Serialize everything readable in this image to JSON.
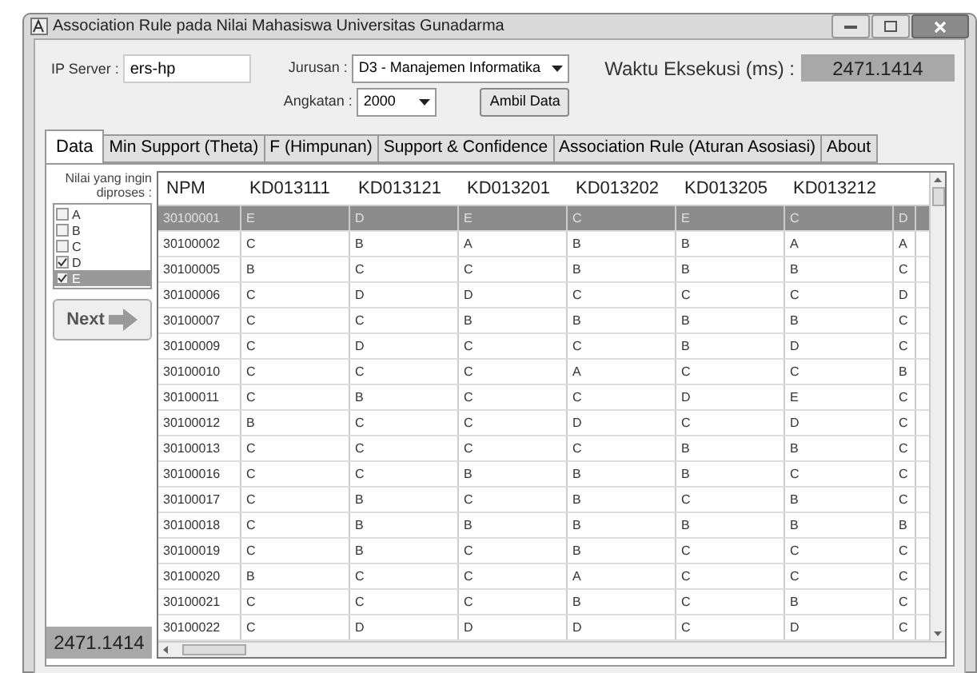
{
  "window": {
    "title": "Association Rule pada Nilai Mahasiswa Universitas Gunadarma"
  },
  "top": {
    "ip_label": "IP Server :",
    "ip_value": "ers-hp",
    "jurusan_label": "Jurusan :",
    "jurusan_value": "D3 - Manajemen Informatika",
    "angkatan_label": "Angkatan :",
    "angkatan_value": "2000",
    "fetch_button": "Ambil Data",
    "time_label": "Waktu Eksekusi (ms) :",
    "time_value": "2471.1414"
  },
  "tabs": [
    {
      "label": "Data",
      "selected": true
    },
    {
      "label": "Min Support (Theta)",
      "selected": false
    },
    {
      "label": "F (Himpunan)",
      "selected": false
    },
    {
      "label": "Support & Confidence",
      "selected": false
    },
    {
      "label": "Association Rule (Aturan Asosiasi)",
      "selected": false
    },
    {
      "label": "About",
      "selected": false
    }
  ],
  "filter": {
    "label": "Nilai yang ingin diproses :",
    "options": [
      {
        "label": "A",
        "checked": false,
        "selected": false
      },
      {
        "label": "B",
        "checked": false,
        "selected": false
      },
      {
        "label": "C",
        "checked": false,
        "selected": false
      },
      {
        "label": "D",
        "checked": true,
        "selected": false
      },
      {
        "label": "E",
        "checked": true,
        "selected": true
      }
    ],
    "next_button": "Next",
    "time_value": "2471.1414"
  },
  "table": {
    "columns": [
      "NPM",
      "KD013111",
      "KD013121",
      "KD013201",
      "KD013202",
      "KD013205",
      "KD013212"
    ],
    "rows": [
      {
        "selected": true,
        "cells": [
          "30100001",
          "E",
          "D",
          "E",
          "C",
          "E",
          "C",
          "D"
        ]
      },
      {
        "selected": false,
        "cells": [
          "30100002",
          "C",
          "B",
          "A",
          "B",
          "B",
          "A",
          "A"
        ]
      },
      {
        "selected": false,
        "cells": [
          "30100005",
          "B",
          "C",
          "C",
          "B",
          "B",
          "B",
          "C"
        ]
      },
      {
        "selected": false,
        "cells": [
          "30100006",
          "C",
          "D",
          "D",
          "C",
          "C",
          "C",
          "D"
        ]
      },
      {
        "selected": false,
        "cells": [
          "30100007",
          "C",
          "C",
          "B",
          "B",
          "B",
          "B",
          "C"
        ]
      },
      {
        "selected": false,
        "cells": [
          "30100009",
          "C",
          "D",
          "C",
          "C",
          "B",
          "D",
          "C"
        ]
      },
      {
        "selected": false,
        "cells": [
          "30100010",
          "C",
          "C",
          "C",
          "A",
          "C",
          "C",
          "B"
        ]
      },
      {
        "selected": false,
        "cells": [
          "30100011",
          "C",
          "B",
          "C",
          "C",
          "D",
          "E",
          "C"
        ]
      },
      {
        "selected": false,
        "cells": [
          "30100012",
          "B",
          "C",
          "C",
          "D",
          "C",
          "D",
          "C"
        ]
      },
      {
        "selected": false,
        "cells": [
          "30100013",
          "C",
          "C",
          "C",
          "C",
          "B",
          "B",
          "C"
        ]
      },
      {
        "selected": false,
        "cells": [
          "30100016",
          "C",
          "C",
          "B",
          "B",
          "B",
          "C",
          "C"
        ]
      },
      {
        "selected": false,
        "cells": [
          "30100017",
          "C",
          "B",
          "C",
          "B",
          "C",
          "B",
          "C"
        ]
      },
      {
        "selected": false,
        "cells": [
          "30100018",
          "C",
          "B",
          "B",
          "B",
          "B",
          "B",
          "B"
        ]
      },
      {
        "selected": false,
        "cells": [
          "30100019",
          "C",
          "B",
          "C",
          "B",
          "C",
          "C",
          "C"
        ]
      },
      {
        "selected": false,
        "cells": [
          "30100020",
          "B",
          "C",
          "C",
          "A",
          "C",
          "C",
          "C"
        ]
      },
      {
        "selected": false,
        "cells": [
          "30100021",
          "C",
          "C",
          "C",
          "B",
          "C",
          "B",
          "C"
        ]
      },
      {
        "selected": false,
        "cells": [
          "30100022",
          "C",
          "D",
          "D",
          "D",
          "C",
          "D",
          "C"
        ]
      }
    ]
  }
}
